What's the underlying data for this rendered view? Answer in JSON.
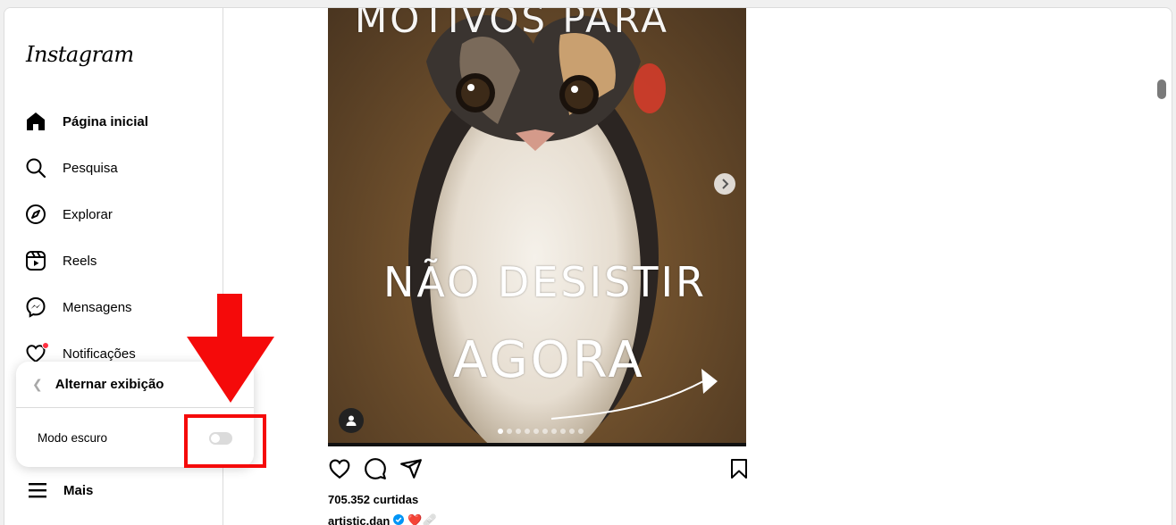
{
  "app": {
    "logo": "Instagram"
  },
  "sidebar": {
    "items": [
      {
        "label": "Página inicial",
        "icon": "home-icon",
        "active": true
      },
      {
        "label": "Pesquisa",
        "icon": "search-icon"
      },
      {
        "label": "Explorar",
        "icon": "compass-icon"
      },
      {
        "label": "Reels",
        "icon": "reels-icon"
      },
      {
        "label": "Mensagens",
        "icon": "messenger-icon"
      },
      {
        "label": "Notificações",
        "icon": "heart-icon"
      }
    ],
    "more_label": "Mais"
  },
  "popover": {
    "title": "Alternar exibição",
    "dark_mode_label": "Modo escuro",
    "dark_mode_on": false
  },
  "post": {
    "image_text": {
      "top": "MOTIVOS PARA",
      "middle": "NÃO DESISTIR",
      "bottom": "AGORA"
    },
    "carousel_total": 10,
    "carousel_current": 1,
    "likes": "705.352 curtidas",
    "author": "artistic.dan",
    "author_verified": true,
    "caption_emoji": "❤️🩹"
  },
  "colors": {
    "notification_dot": "#ff3040",
    "annotation_red": "#f50a0a",
    "verified_blue": "#0095f6"
  }
}
